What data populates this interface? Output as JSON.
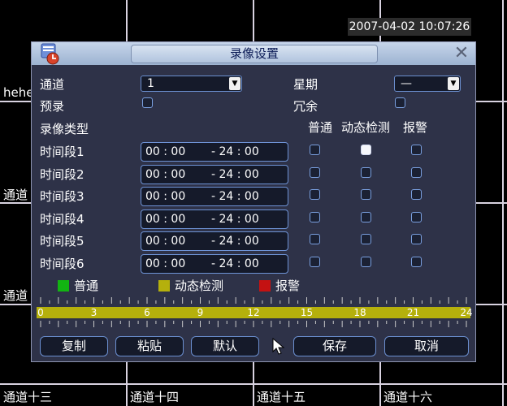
{
  "timestamp": "2007-04-02 10:07:26",
  "background_channels": {
    "left_partial": "hehe",
    "ch_left_1": "通道",
    "ch_left_2": "通道",
    "ch13": "通道十三",
    "ch14": "通道十四",
    "ch15": "通道十五",
    "ch16": "通道十六"
  },
  "dialog": {
    "title": "录像设置",
    "channel_label": "通道",
    "channel_value": "1",
    "weekday_label": "星期",
    "weekday_value": "—",
    "prerecord_label": "预录",
    "prerecord_checked": false,
    "redundant_label": "冗余",
    "redundant_checked": false,
    "record_type_label": "录像类型",
    "col_headers": [
      "普通",
      "动态检测",
      "报警"
    ],
    "periods": [
      {
        "label": "时间段1",
        "start": "00 : 00",
        "end": "- 24 : 00",
        "regular": false,
        "motion": true,
        "alarm": false
      },
      {
        "label": "时间段2",
        "start": "00 : 00",
        "end": "- 24 : 00",
        "regular": false,
        "motion": false,
        "alarm": false
      },
      {
        "label": "时间段3",
        "start": "00 : 00",
        "end": "- 24 : 00",
        "regular": false,
        "motion": false,
        "alarm": false
      },
      {
        "label": "时间段4",
        "start": "00 : 00",
        "end": "- 24 : 00",
        "regular": false,
        "motion": false,
        "alarm": false
      },
      {
        "label": "时间段5",
        "start": "00 : 00",
        "end": "- 24 : 00",
        "regular": false,
        "motion": false,
        "alarm": false
      },
      {
        "label": "时间段6",
        "start": "00 : 00",
        "end": "- 24 : 00",
        "regular": false,
        "motion": false,
        "alarm": false
      }
    ],
    "legend": [
      {
        "label": "普通",
        "color": "#12b412"
      },
      {
        "label": "动态检测",
        "color": "#b5b00c"
      },
      {
        "label": "报警",
        "color": "#c41212"
      }
    ],
    "timeline_hours": [
      "0",
      "3",
      "6",
      "9",
      "12",
      "15",
      "18",
      "21",
      "24"
    ],
    "timeline_fill_color": "#b5b00c",
    "buttons": {
      "copy": "复制",
      "paste": "粘贴",
      "default": "默认",
      "save": "保存",
      "cancel": "取消"
    }
  }
}
